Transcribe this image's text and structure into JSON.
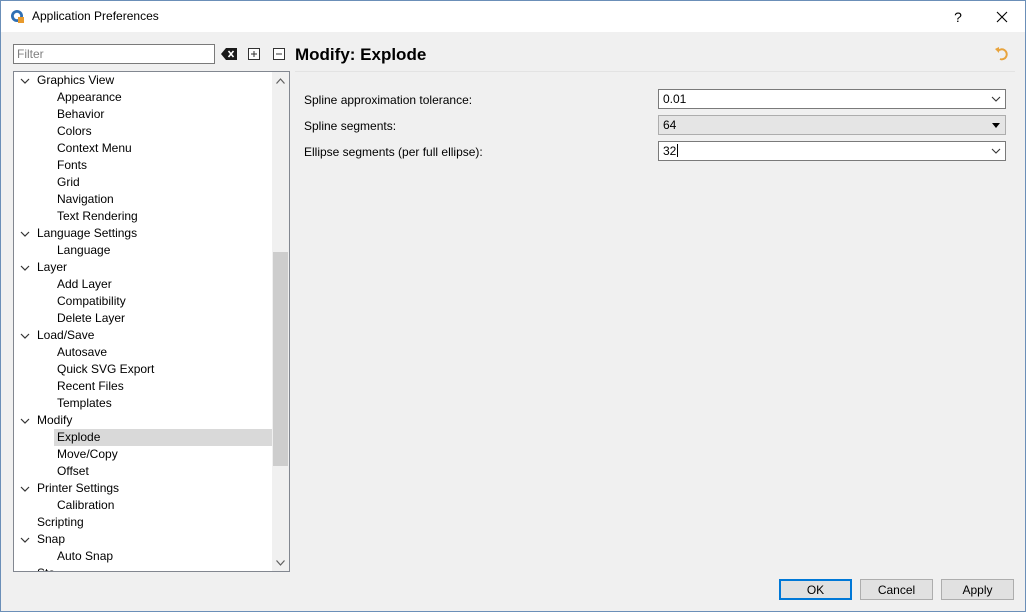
{
  "window": {
    "title": "Application Preferences",
    "help_label": "?",
    "close_label": "✕"
  },
  "filter": {
    "placeholder": "Filter",
    "value": ""
  },
  "tree": {
    "items": [
      {
        "label": "Graphics View",
        "level": 0,
        "expanded": true
      },
      {
        "label": "Appearance",
        "level": 1
      },
      {
        "label": "Behavior",
        "level": 1
      },
      {
        "label": "Colors",
        "level": 1
      },
      {
        "label": "Context Menu",
        "level": 1
      },
      {
        "label": "Fonts",
        "level": 1
      },
      {
        "label": "Grid",
        "level": 1
      },
      {
        "label": "Navigation",
        "level": 1
      },
      {
        "label": "Text Rendering",
        "level": 1
      },
      {
        "label": "Language Settings",
        "level": 0,
        "expanded": true
      },
      {
        "label": "Language",
        "level": 1
      },
      {
        "label": "Layer",
        "level": 0,
        "expanded": true
      },
      {
        "label": "Add Layer",
        "level": 1
      },
      {
        "label": "Compatibility",
        "level": 1
      },
      {
        "label": "Delete Layer",
        "level": 1
      },
      {
        "label": "Load/Save",
        "level": 0,
        "expanded": true
      },
      {
        "label": "Autosave",
        "level": 1
      },
      {
        "label": "Quick SVG Export",
        "level": 1
      },
      {
        "label": "Recent Files",
        "level": 1
      },
      {
        "label": "Templates",
        "level": 1
      },
      {
        "label": "Modify",
        "level": 0,
        "expanded": true
      },
      {
        "label": "Explode",
        "level": 1,
        "selected": true
      },
      {
        "label": "Move/Copy",
        "level": 1
      },
      {
        "label": "Offset",
        "level": 1
      },
      {
        "label": "Printer Settings",
        "level": 0,
        "expanded": true
      },
      {
        "label": "Calibration",
        "level": 1
      },
      {
        "label": "Scripting",
        "level": 0,
        "expanded": false,
        "leaf": true
      },
      {
        "label": "Snap",
        "level": 0,
        "expanded": true
      },
      {
        "label": "Auto Snap",
        "level": 1
      },
      {
        "label": "Sta",
        "level": 0,
        "partial": true
      }
    ]
  },
  "page": {
    "title": "Modify: Explode"
  },
  "fields": [
    {
      "label": "Spline approximation tolerance:",
      "value": "0.01",
      "readonly": false
    },
    {
      "label": "Spline segments:",
      "value": "64",
      "readonly": true
    },
    {
      "label": "Ellipse segments (per full ellipse):",
      "value": "32",
      "readonly": false
    }
  ],
  "buttons": {
    "ok": "OK",
    "cancel": "Cancel",
    "apply": "Apply"
  },
  "colors": {
    "accent": "#0078d7",
    "selection": "#d9d9d9",
    "reset_icon": "#e8a33c"
  }
}
